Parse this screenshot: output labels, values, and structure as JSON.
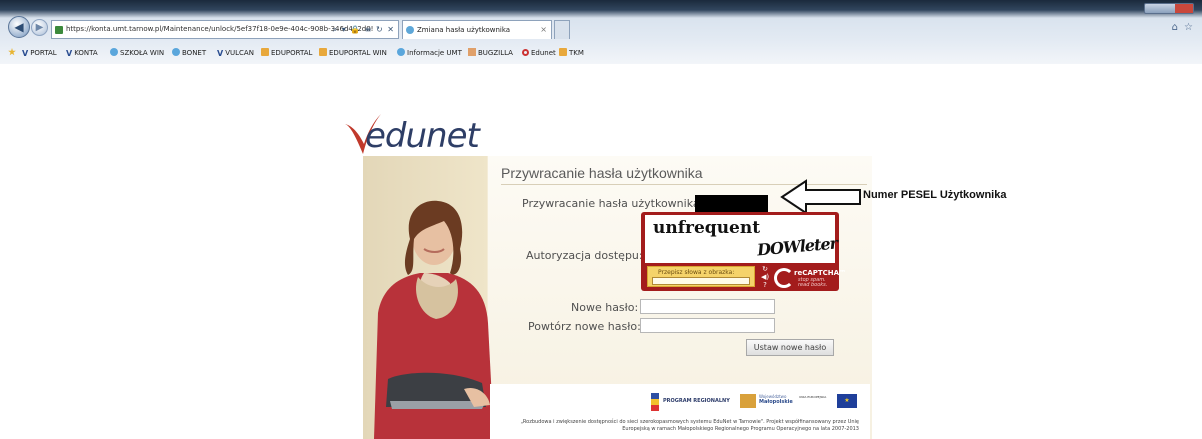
{
  "browser": {
    "url": "https://konta.umt.tarnow.pl/Maintenance/unlock/5ef37f18-0e9e-404c-908b-346d492d0!",
    "url_tools": "⌕ ▾ 🔒 ≡ ↻ ✕",
    "tab_title": "Zmiana hasła użytkownika",
    "tab_close": "×",
    "favorites": [
      "PORTAL",
      "KONTA",
      "SZKOŁA WIN",
      "BONET",
      "VULCAN",
      "EDUPORTAL",
      "EDUPORTAL WIN",
      "Informacje UMT",
      "BUGZILLA",
      "Edunet",
      "TKM"
    ]
  },
  "logo": {
    "text": "edunet"
  },
  "form": {
    "title": "Przywracanie hasła użytkownika",
    "user_label": "Przywracanie hasła użytkownika:",
    "auth_label": "Autoryzacja dostępu:",
    "new_password_label": "Nowe hasło:",
    "repeat_password_label": "Powtórz nowe hasło:",
    "submit_label": "Ustaw nowe hasło"
  },
  "captcha": {
    "word1": "unfrequent",
    "word2": "DOWleter",
    "hint": "Przepisz słowa z obrazka:",
    "brand": "reCAPTCHA™",
    "slogan1": "stop spam.",
    "slogan2": "read books."
  },
  "annotation": {
    "text": "Numer PESEL Użytkownika"
  },
  "footer": {
    "program": "PROGRAM REGIONALNY",
    "region_small": "Województwo",
    "region": "Małopolskie",
    "eu_text": "UNIA EUROPEJSKA",
    "text": "„Rozbudowa i zwiększenie dostępności do sieci szerokopasmowych systemu EduNet w Tarnowie\". Projekt współfinansowany przez Unię Europejską w ramach Małopolskiego Regionalnego Programu Operacyjnego na lata 2007-2013"
  },
  "colors": {
    "captcha_red": "#a31c1c",
    "logo_blue": "#2e3e66",
    "logo_red": "#c0392b"
  }
}
